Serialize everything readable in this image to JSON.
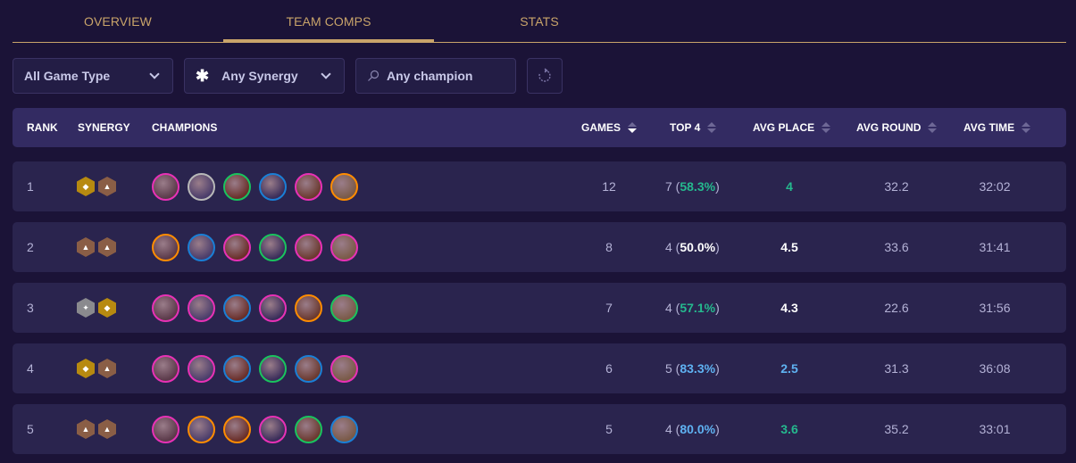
{
  "tabs": [
    {
      "label": "OVERVIEW",
      "active": false
    },
    {
      "label": "TEAM COMPS",
      "active": true
    },
    {
      "label": "STATS",
      "active": false
    }
  ],
  "filters": {
    "game_type": "All Game Type",
    "synergy": "Any Synergy",
    "champion_placeholder": "Any champion"
  },
  "table": {
    "headers": {
      "rank": "RANK",
      "synergy": "SYNERGY",
      "champions": "CHAMPIONS",
      "games": "GAMES",
      "top4": "TOP 4",
      "avg_place": "AVG PLACE",
      "avg_round": "AVG ROUND",
      "avg_time": "AVG TIME"
    },
    "sorted_by": "GAMES",
    "colors": {
      "green": "#25b98e",
      "white": "#ffffff",
      "blue": "#5fb2f2",
      "gold": "#c9a46a"
    },
    "rows": [
      {
        "rank": "1",
        "synergies": [
          "gold",
          "bronze"
        ],
        "champions": [
          "pink",
          "gray",
          "green",
          "blue",
          "pink",
          "orange"
        ],
        "games": "12",
        "top4_count": "7",
        "top4_pct": "58.3%",
        "top4_color": "green",
        "avg_place": "4",
        "avg_place_color": "green",
        "avg_round": "32.2",
        "avg_time": "32:02"
      },
      {
        "rank": "2",
        "synergies": [
          "bronze",
          "bronze"
        ],
        "champions": [
          "orange",
          "blue",
          "pink",
          "green",
          "pink",
          "pink"
        ],
        "games": "8",
        "top4_count": "4",
        "top4_pct": "50.0%",
        "top4_color": "white",
        "avg_place": "4.5",
        "avg_place_color": "white",
        "avg_round": "33.6",
        "avg_time": "31:41"
      },
      {
        "rank": "3",
        "synergies": [
          "silver",
          "gold"
        ],
        "champions": [
          "pink",
          "pink",
          "blue",
          "pink",
          "orange",
          "green"
        ],
        "games": "7",
        "top4_count": "4",
        "top4_pct": "57.1%",
        "top4_color": "green",
        "avg_place": "4.3",
        "avg_place_color": "white",
        "avg_round": "22.6",
        "avg_time": "31:56"
      },
      {
        "rank": "4",
        "synergies": [
          "gold",
          "bronze"
        ],
        "champions": [
          "pink",
          "pink",
          "blue",
          "green",
          "blue",
          "pink"
        ],
        "games": "6",
        "top4_count": "5",
        "top4_pct": "83.3%",
        "top4_color": "blue",
        "avg_place": "2.5",
        "avg_place_color": "blue",
        "avg_round": "31.3",
        "avg_time": "36:08"
      },
      {
        "rank": "5",
        "synergies": [
          "bronze",
          "bronze"
        ],
        "champions": [
          "pink",
          "orange",
          "orange",
          "pink",
          "green",
          "blue"
        ],
        "games": "5",
        "top4_count": "4",
        "top4_pct": "80.0%",
        "top4_color": "blue",
        "avg_place": "3.6",
        "avg_place_color": "green",
        "avg_round": "35.2",
        "avg_time": "33:01"
      }
    ]
  }
}
